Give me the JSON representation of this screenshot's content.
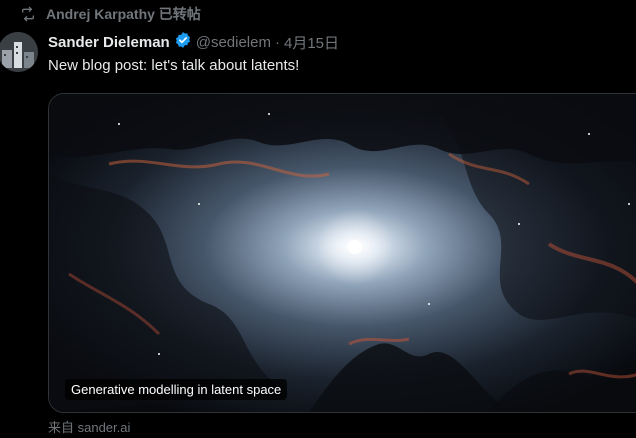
{
  "repost": {
    "icon": "repost-icon",
    "text": "Andrej Karpathy 已转帖"
  },
  "tweet": {
    "author_name": "Sander Dieleman",
    "verified_icon": "verified-badge-icon",
    "handle": "@sedielem",
    "separator": "·",
    "date": "4月15日",
    "text": "New blog post: let's talk about latents!"
  },
  "link_card": {
    "image": "nebula-image",
    "title": "Generative modelling in latent space",
    "source": "来自 sander.ai"
  },
  "colors": {
    "background": "#000000",
    "text_primary": "#e7e9ea",
    "text_secondary": "#71767b",
    "verified_blue": "#1d9bf0",
    "card_border": "#2f3336"
  }
}
